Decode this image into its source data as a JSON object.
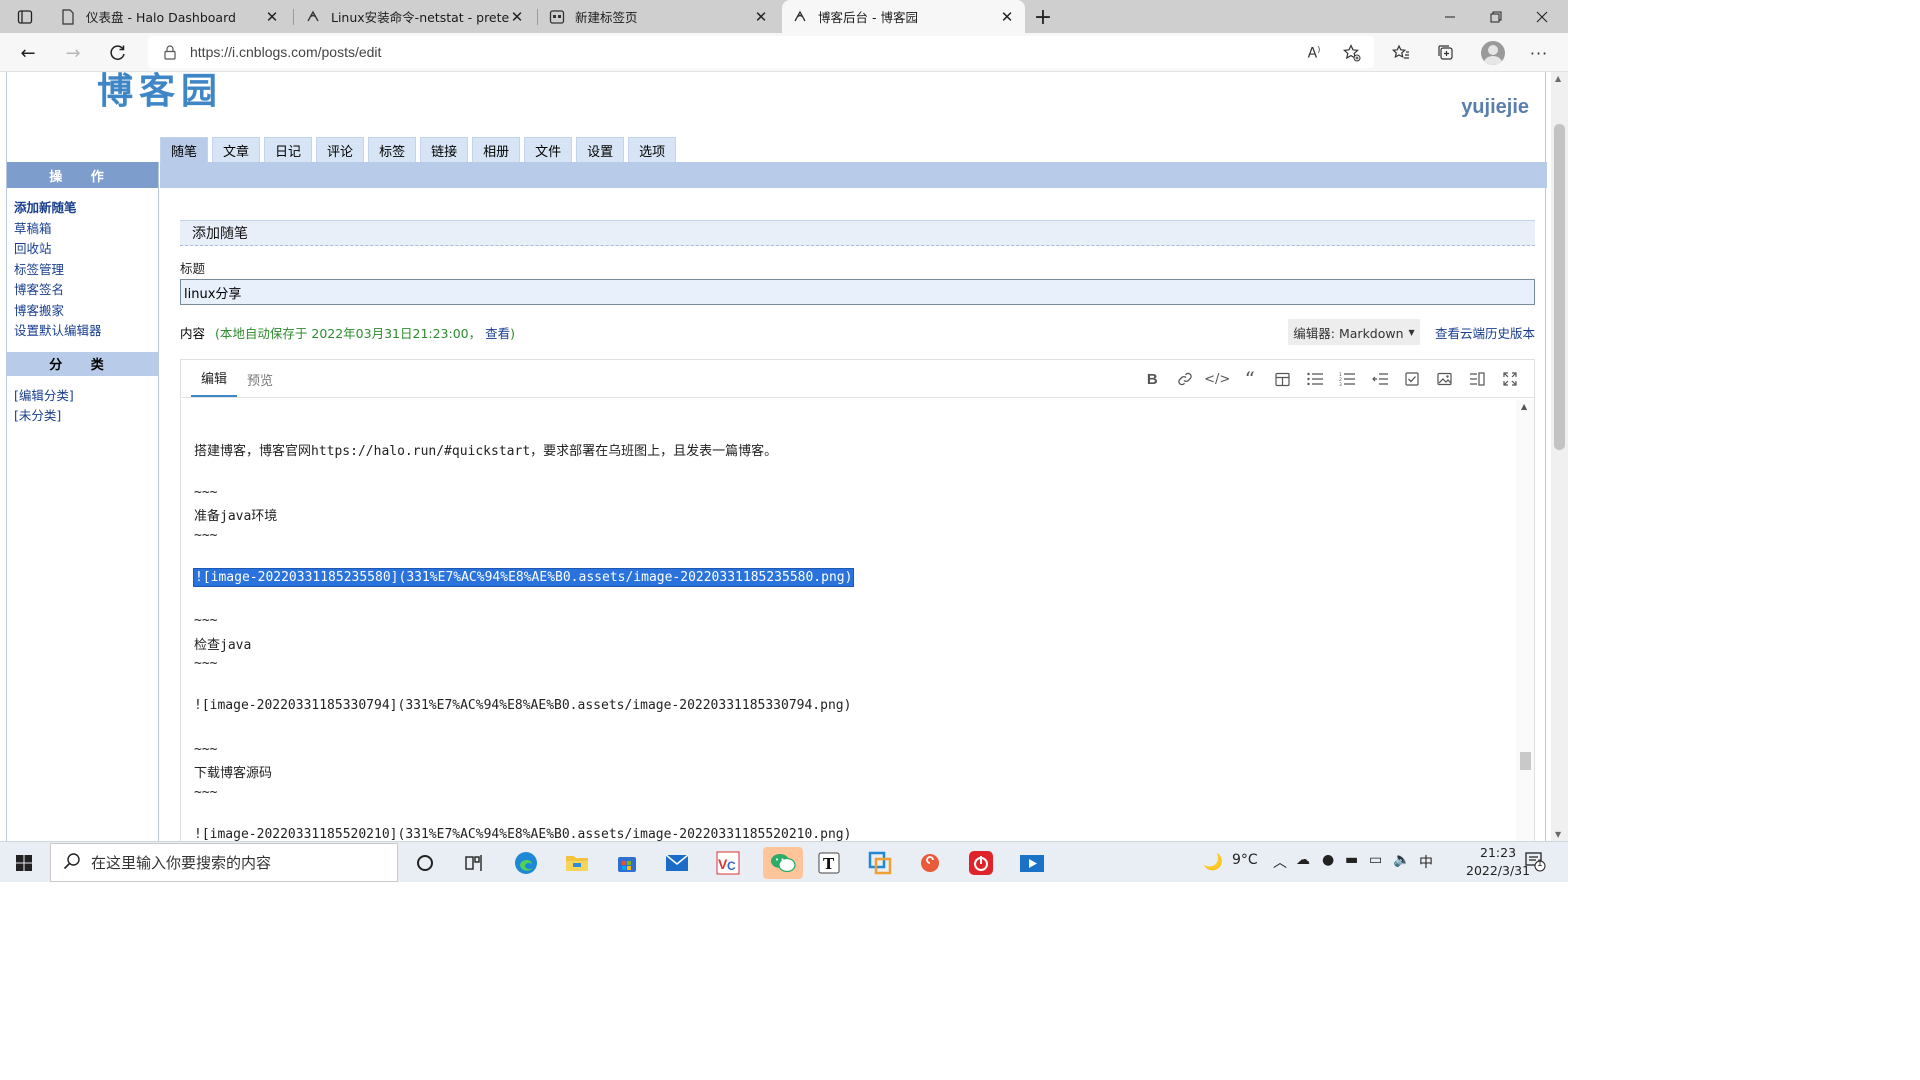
{
  "browser": {
    "tabs": [
      {
        "title": "仪表盘 - Halo Dashboard",
        "active": false
      },
      {
        "title": "Linux安装命令-netstat - pretend",
        "active": false
      },
      {
        "title": "新建标签页",
        "active": false
      },
      {
        "title": "博客后台 - 博客园",
        "active": true
      }
    ],
    "url": "https://i.cnblogs.com/posts/edit"
  },
  "site": {
    "logo_text": "博客园",
    "username": "yujiejie"
  },
  "main_tabs": [
    "随笔",
    "文章",
    "日记",
    "评论",
    "标签",
    "链接",
    "相册",
    "文件",
    "设置",
    "选项"
  ],
  "sidebar": {
    "ops_header": "操 作",
    "ops_links": [
      "添加新随笔",
      "草稿箱",
      "回收站",
      "标签管理",
      "博客签名",
      "博客搬家",
      "设置默认编辑器"
    ],
    "cat_header": "分 类",
    "cat_links": [
      "[编辑分类]",
      "[未分类]"
    ]
  },
  "form": {
    "section_title": "添加随笔",
    "title_label": "标题",
    "title_value": "linux分享",
    "content_label": "内容",
    "autosave_text": "(本地自动保存于 2022年03月31日21:23:00，",
    "autosave_view": "查看",
    "autosave_close": ")",
    "editor_select": "编辑器: Markdown",
    "history_link": "查看云端历史版本"
  },
  "editor": {
    "tabs": [
      "编辑",
      "预览"
    ],
    "lines": [
      {
        "text": "搭建博客，博客官网https://halo.run/#quickstart，要求部署在乌班图上，且发表一篇博客。",
        "selected": false
      },
      {
        "text": "~~~",
        "selected": false
      },
      {
        "text": "准备java环境",
        "selected": false
      },
      {
        "text": "~~~",
        "selected": false
      },
      {
        "text": "![image-20220331185235580](331%E7%AC%94%E8%AE%B0.assets/image-20220331185235580.png)",
        "selected": true
      },
      {
        "text": "~~~",
        "selected": false
      },
      {
        "text": "检查java",
        "selected": false
      },
      {
        "text": "~~~",
        "selected": false
      },
      {
        "text": "![image-20220331185330794](331%E7%AC%94%E8%AE%B0.assets/image-20220331185330794.png)",
        "selected": false
      },
      {
        "text": "~~~",
        "selected": false
      },
      {
        "text": "下载博客源码",
        "selected": false
      },
      {
        "text": "~~~",
        "selected": false
      },
      {
        "text": "![image-20220331185520210](331%E7%AC%94%E8%AE%B0.assets/image-20220331185520210.png)",
        "selected": false
      }
    ]
  },
  "taskbar": {
    "search_placeholder": "在这里输入你要搜索的内容",
    "weather": "9°C",
    "ime": "中",
    "time": "21:23",
    "date": "2022/3/31",
    "notification_count": "1"
  },
  "colors": {
    "accent": "#3f86c6",
    "nav_blue": "#b8cbe8",
    "side_header": "#7d9dcc",
    "selection": "#2a73dc",
    "autosave_green": "#2e8b2e",
    "link_blue": "#1a3f8e"
  }
}
